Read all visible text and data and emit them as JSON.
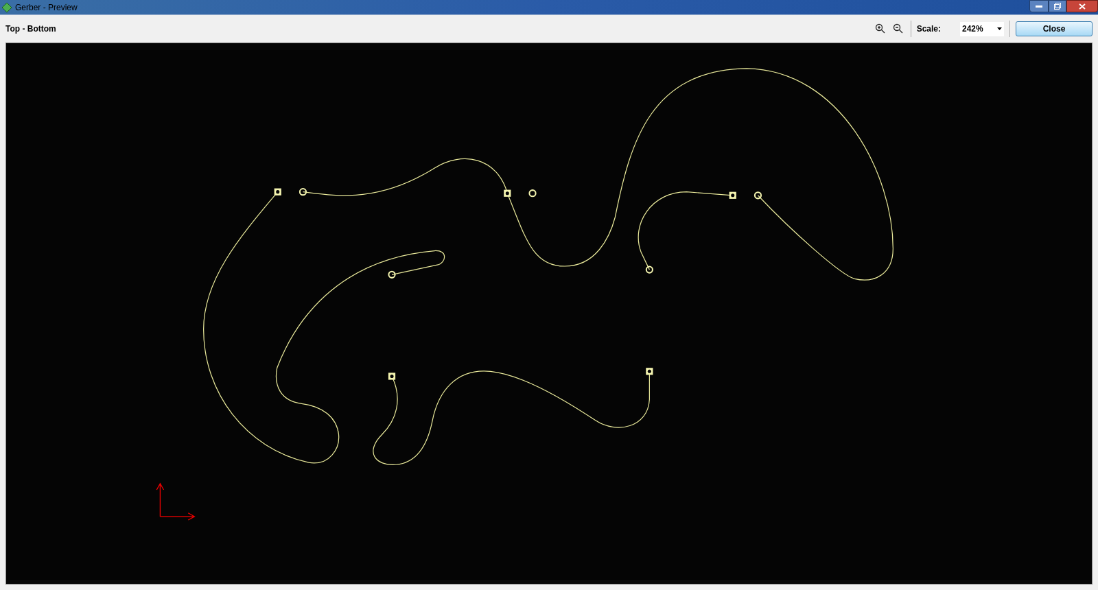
{
  "window": {
    "title": "Gerber - Preview"
  },
  "toolbar": {
    "layer": "Top - Bottom",
    "scale_label": "Scale:",
    "scale_value": "242%",
    "close_button": "Close"
  }
}
